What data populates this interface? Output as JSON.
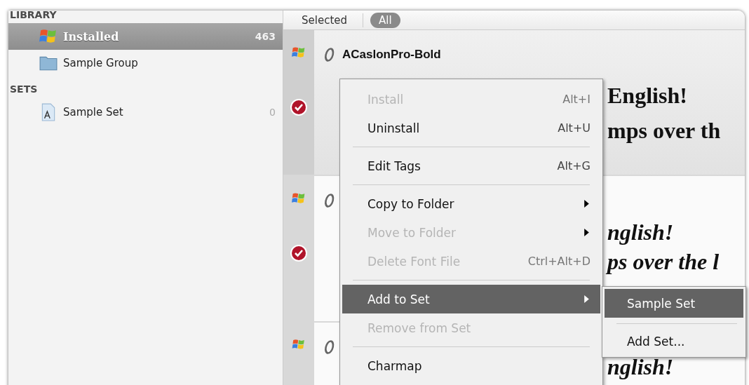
{
  "sidebar": {
    "sections": [
      {
        "title": "LIBRARY",
        "items": [
          {
            "label": "Installed",
            "count": "463",
            "kind": "system",
            "selected": true
          },
          {
            "label": "Sample Group",
            "kind": "group",
            "selected": false
          }
        ]
      },
      {
        "title": "SETS",
        "items": [
          {
            "label": "Sample Set",
            "count": "0",
            "kind": "set",
            "selected": false
          }
        ]
      }
    ]
  },
  "view_tabs": [
    {
      "label": "Selected",
      "selected": false
    },
    {
      "label": "All",
      "selected": true
    }
  ],
  "fonts": [
    {
      "name": "ACaslonPro-Bold",
      "selected": true,
      "kind": "upright",
      "samples": [
        "English!",
        "mps over th"
      ]
    },
    {
      "selected": false,
      "kind": "italic",
      "samples": [
        "nglish!",
        "ps over the l"
      ]
    },
    {
      "selected": false,
      "kind": "italic",
      "samples": [
        "nglish!"
      ]
    }
  ],
  "context_menu": [
    {
      "kind": "item",
      "label": "Install",
      "shortcut": "Alt+I",
      "disabled": true
    },
    {
      "kind": "item",
      "label": "Uninstall",
      "shortcut": "Alt+U",
      "disabled": false
    },
    {
      "kind": "separator"
    },
    {
      "kind": "item",
      "label": "Edit Tags",
      "shortcut": "Alt+G",
      "disabled": false
    },
    {
      "kind": "separator"
    },
    {
      "kind": "submenu",
      "label": "Copy to Folder",
      "disabled": false
    },
    {
      "kind": "submenu",
      "label": "Move to Folder",
      "disabled": true
    },
    {
      "kind": "item",
      "label": "Delete Font File",
      "shortcut": "Ctrl+Alt+D",
      "disabled": true
    },
    {
      "kind": "separator"
    },
    {
      "kind": "submenu",
      "label": "Add to Set",
      "disabled": false,
      "highlighted": true
    },
    {
      "kind": "item",
      "label": "Remove from Set",
      "disabled": true
    },
    {
      "kind": "separator"
    },
    {
      "kind": "item",
      "label": "Charmap",
      "disabled": false
    }
  ],
  "submenu": [
    {
      "kind": "item",
      "label": "Sample Set",
      "highlighted": true
    },
    {
      "kind": "separator"
    },
    {
      "kind": "item",
      "label": "Add Set...",
      "highlighted": false
    }
  ]
}
